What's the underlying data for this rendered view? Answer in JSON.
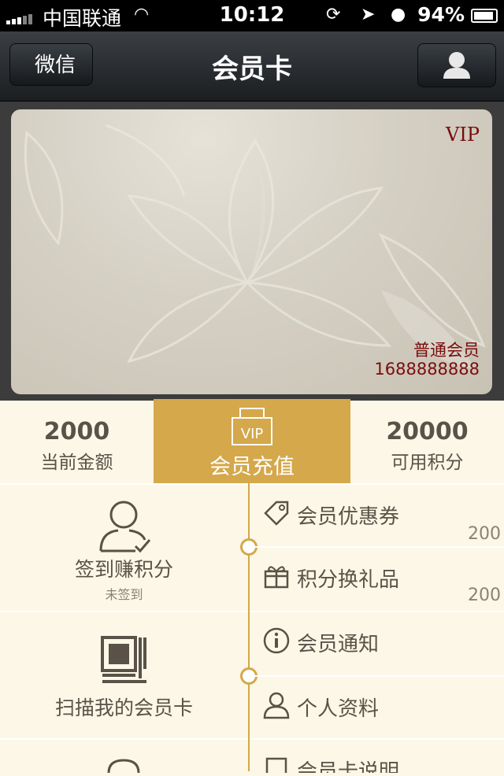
{
  "status": {
    "carrier": "中国联通",
    "time": "10:12",
    "battery": "94%"
  },
  "nav": {
    "back": "微信",
    "title": "会员卡"
  },
  "card": {
    "vip": "VIP",
    "level": "普通会员",
    "number": "1688888888"
  },
  "stats": {
    "balance_value": "2000",
    "balance_label": "当前金额",
    "recharge_badge": "VIP",
    "recharge_label": "会员充值",
    "points_value": "20000",
    "points_label": "可用积分"
  },
  "left": {
    "checkin_label": "签到赚积分",
    "checkin_status": "未签到",
    "scan_label": "扫描我的会员卡"
  },
  "menu": [
    {
      "label": "会员优惠券",
      "count": "200"
    },
    {
      "label": "积分换礼品",
      "count": "200"
    },
    {
      "label": "会员通知",
      "count": ""
    },
    {
      "label": "个人资料",
      "count": ""
    },
    {
      "label": "会员卡说明",
      "count": ""
    }
  ],
  "colors": {
    "accent": "#d4a84b",
    "card_text": "#7a0c0c",
    "text": "#5a5248",
    "background": "#fcf7e6"
  }
}
